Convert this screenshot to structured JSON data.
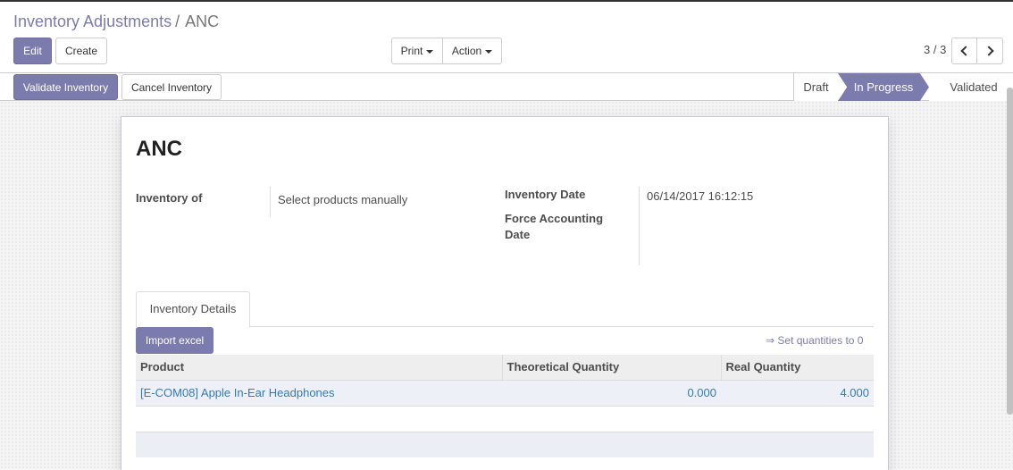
{
  "breadcrumb": {
    "parent": "Inventory Adjustments",
    "separator": "/",
    "current": "ANC"
  },
  "toolbar": {
    "edit_label": "Edit",
    "create_label": "Create",
    "print_label": "Print",
    "action_label": "Action"
  },
  "pager": {
    "value": "3 / 3"
  },
  "statusbar": {
    "validate_label": "Validate Inventory",
    "cancel_label": "Cancel Inventory",
    "stages": [
      "Draft",
      "In Progress",
      "Validated"
    ],
    "active_stage": "In Progress"
  },
  "form": {
    "title": "ANC",
    "inventory_of_label": "Inventory of",
    "inventory_of_value": "Select products manually",
    "inventory_date_label": "Inventory Date",
    "inventory_date_value": "06/14/2017 16:12:15",
    "force_accounting_label_line1": "Force Accounting",
    "force_accounting_label_line2": "Date"
  },
  "notebook": {
    "tab_label": "Inventory Details",
    "import_label": "Import excel",
    "set_zero_label": "⇒ Set quantities to 0"
  },
  "table": {
    "columns": [
      "Product",
      "Theoretical Quantity",
      "Real Quantity"
    ],
    "rows": [
      {
        "product": "[E-COM08] Apple In-Ear Headphones",
        "theoretical": "0.000",
        "real": "4.000"
      }
    ]
  },
  "colors": {
    "accent": "#7c7bad",
    "link": "#337ab7"
  },
  "icons": {
    "pager_prev": "chevron-left-icon",
    "pager_next": "chevron-right-icon",
    "dropdown": "caret-down-icon"
  }
}
